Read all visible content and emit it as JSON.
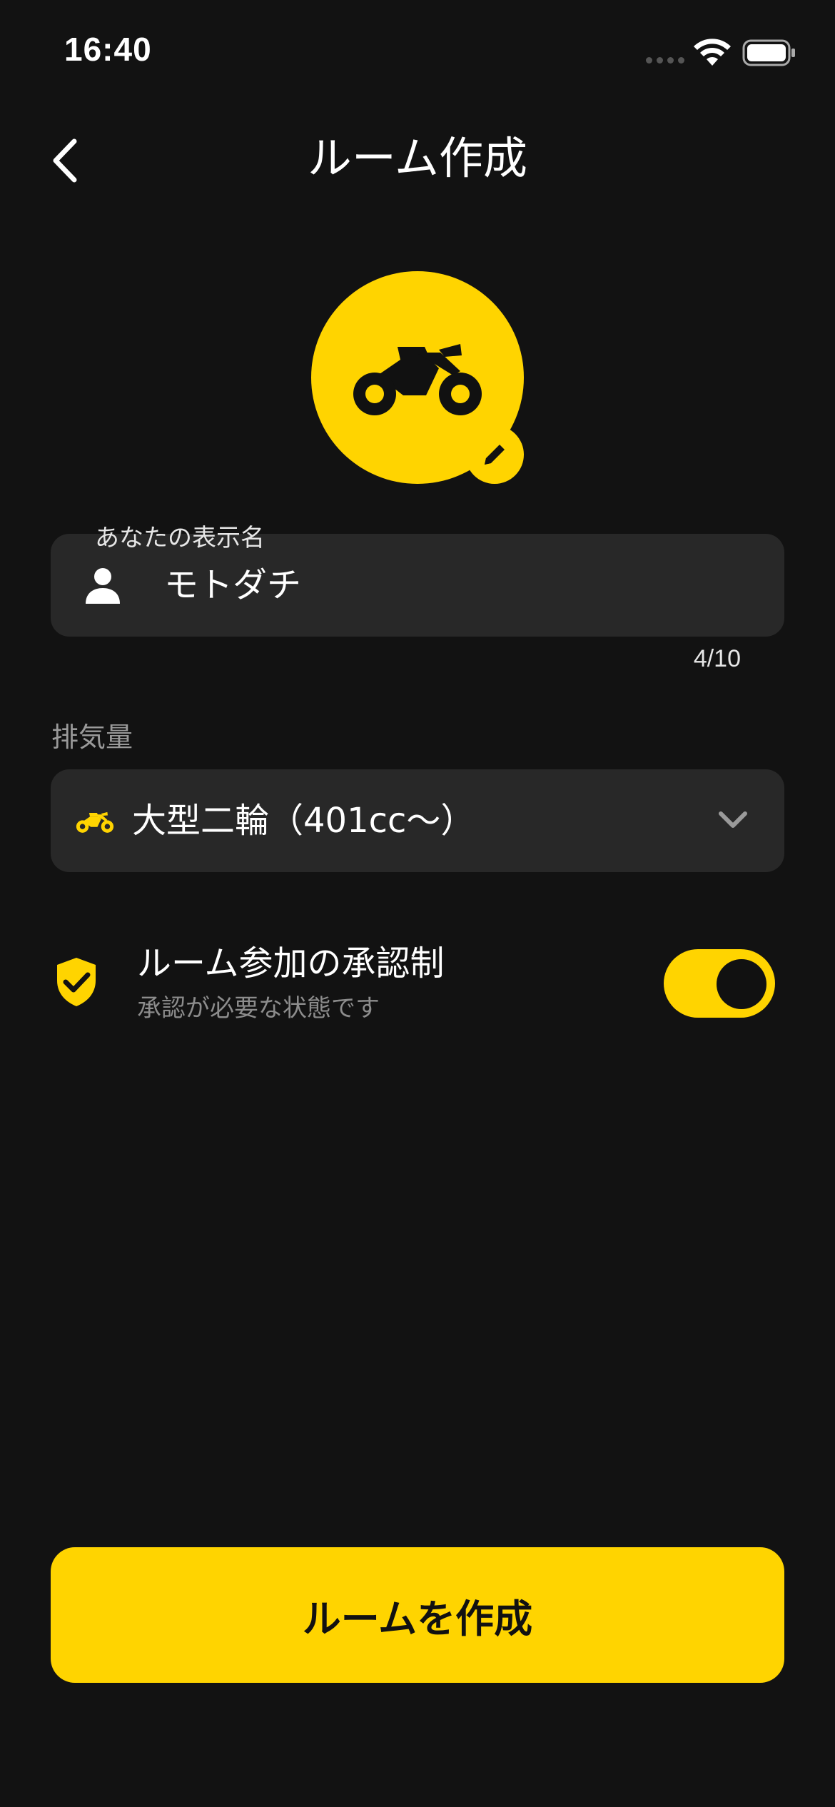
{
  "status_bar": {
    "time": "16:40"
  },
  "header": {
    "title": "ルーム作成",
    "back_icon": "chevron-left-icon"
  },
  "avatar": {
    "icon": "motorcycle-icon",
    "edit_icon": "pencil-icon",
    "background_color": "#ffd400"
  },
  "name_field": {
    "label": "あなたの表示名",
    "icon": "person-icon",
    "value": "モトダチ",
    "char_count": "4/10"
  },
  "displacement": {
    "label": "排気量",
    "icon": "motorcycle-icon",
    "selected": "大型二輪（401cc～）",
    "dropdown_icon": "chevron-down-icon"
  },
  "approval": {
    "icon": "shield-check-icon",
    "title": "ルーム参加の承認制",
    "subtitle": "承認が必要な状態です",
    "enabled": true
  },
  "create_button": {
    "label": "ルームを作成"
  },
  "colors": {
    "accent": "#ffd400",
    "background": "#121212",
    "field": "#282828"
  }
}
